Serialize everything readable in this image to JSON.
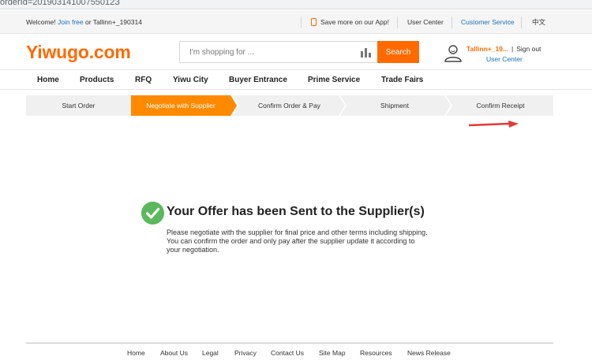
{
  "browser": {
    "url_fragment": "orderId=20190314100755012З"
  },
  "topbar": {
    "welcome": "Welcome!",
    "join_free": "Join free",
    "or": "or",
    "username": "Tallinn+_190314",
    "save_app": "Save more on our App!",
    "user_center": "User Center",
    "customer_service": "Customer Service",
    "language": "中文"
  },
  "header": {
    "logo": "Yiwugo.com",
    "search": {
      "placeholder": "I'm shopping for ...",
      "button": "Search"
    },
    "user": {
      "name": "Tallinn+_19...",
      "sep": "|",
      "signout": "Sign out",
      "user_center": "User Center"
    }
  },
  "nav": {
    "items": [
      "Home",
      "Products",
      "RFQ",
      "Yiwu City",
      "Buyer Entrance",
      "Prime Service",
      "Trade Fairs"
    ]
  },
  "steps": {
    "items": [
      "Start Order",
      "Negotiate with Supplier",
      "Confirm Order & Pay",
      "Shipment",
      "Confirm Receipt"
    ],
    "active": 1
  },
  "main": {
    "title": "Your Offer has been Sent to the Supplier(s)",
    "message": "Please negotiate with the supplier for final price and other terms including shipping. You can confirm the order and only pay after the supplier update it according to your negotiation."
  },
  "footer": {
    "links": [
      "Home",
      "About Us",
      "Legal",
      "Privacy",
      "Contact Us",
      "Site Map",
      "Resources",
      "News Release"
    ]
  },
  "colors": {
    "brand": "#ff6a00",
    "step_active": "#ff8a00",
    "link": "#1a6fc2",
    "success": "#5cb85c",
    "annotation": "#e53935"
  }
}
